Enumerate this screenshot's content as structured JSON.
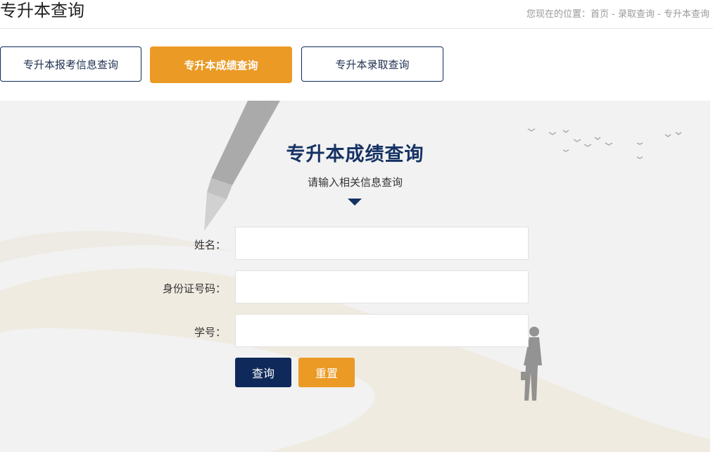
{
  "header": {
    "title": "专升本查询",
    "breadcrumb": {
      "prefix": "您现在的位置：",
      "items": [
        "首页",
        "录取查询",
        "专升本查询"
      ],
      "separator": " - "
    }
  },
  "tabs": [
    {
      "label": "专升本报考信息查询",
      "active": false
    },
    {
      "label": "专升本成绩查询",
      "active": true
    },
    {
      "label": "专升本录取查询",
      "active": false
    }
  ],
  "form": {
    "title": "专升本成绩查询",
    "subtitle": "请输入相关信息查询",
    "fields": [
      {
        "label": "姓名：",
        "value": "",
        "placeholder": ""
      },
      {
        "label": "身份证号码：",
        "value": "",
        "placeholder": ""
      },
      {
        "label": "学号：",
        "value": "",
        "placeholder": ""
      }
    ],
    "query_label": "查询",
    "reset_label": "重置"
  },
  "colors": {
    "primary_navy": "#0f2a5a",
    "accent_orange": "#ea9a25",
    "panel_bg": "#f2f2f2"
  }
}
